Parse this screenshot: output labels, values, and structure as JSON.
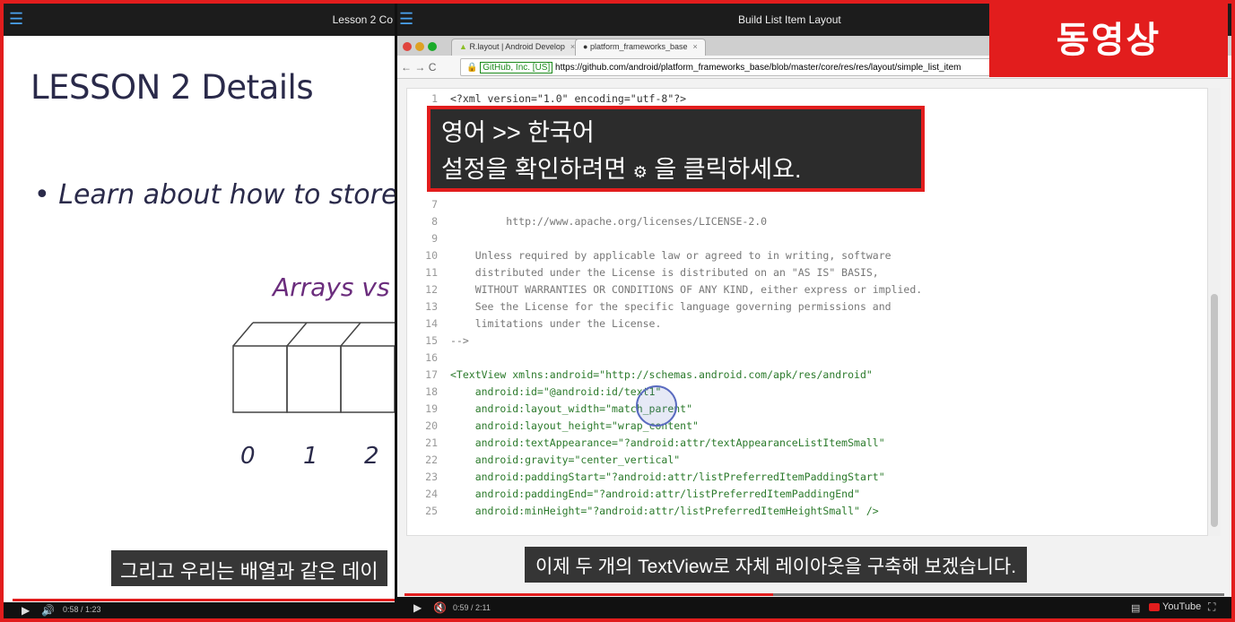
{
  "colors": {
    "accent_red": "#e21d1d",
    "brand_blue": "#4aa3f0"
  },
  "badge": {
    "label": "동영상"
  },
  "left_player": {
    "menu_icon": "menu-icon",
    "title": "Lesson 2 Co",
    "lesson_heading": "LESSON 2 Details",
    "bullet_text": "• Learn about how to store",
    "arrays_text": "Arrays vs",
    "indices": [
      "0",
      "1",
      "2"
    ],
    "subtitle": "그리고 우리는 배열과 같은 데이",
    "time": "0:58 / 1:23",
    "progress": 1.0
  },
  "right_player": {
    "menu_icon": "menu-icon",
    "title": "Build List Item Layout",
    "tabs": [
      {
        "label": "R.layout | Android Develop",
        "icon": "android-icon"
      },
      {
        "label": "platform_frameworks_base",
        "icon": "github-icon"
      }
    ],
    "address": {
      "cert": "GitHub, Inc. [US]",
      "url": "https://github.com/android/platform_frameworks_base/blob/master/core/res/res/layout/simple_list_item"
    },
    "code_lines": [
      {
        "n": "1",
        "text": "<?xml version=\"1.0\" encoding=\"utf-8\"?>"
      },
      {
        "n": "7",
        "text": ""
      },
      {
        "n": "8",
        "text": "         http://www.apache.org/licenses/LICENSE-2.0"
      },
      {
        "n": "9",
        "text": ""
      },
      {
        "n": "10",
        "text": "    Unless required by applicable law or agreed to in writing, software"
      },
      {
        "n": "11",
        "text": "    distributed under the License is distributed on an \"AS IS\" BASIS,"
      },
      {
        "n": "12",
        "text": "    WITHOUT WARRANTIES OR CONDITIONS OF ANY KIND, either express or implied."
      },
      {
        "n": "13",
        "text": "    See the License for the specific language governing permissions and"
      },
      {
        "n": "14",
        "text": "    limitations under the License."
      },
      {
        "n": "15",
        "text": "-->"
      },
      {
        "n": "16",
        "text": ""
      },
      {
        "n": "17",
        "text": "<TextView xmlns:android=\"http://schemas.android.com/apk/res/android\""
      },
      {
        "n": "18",
        "text": "    android:id=\"@android:id/text1\""
      },
      {
        "n": "19",
        "text": "    android:layout_width=\"match_parent\""
      },
      {
        "n": "20",
        "text": "    android:layout_height=\"wrap_content\""
      },
      {
        "n": "21",
        "text": "    android:textAppearance=\"?android:attr/textAppearanceListItemSmall\""
      },
      {
        "n": "22",
        "text": "    android:gravity=\"center_vertical\""
      },
      {
        "n": "23",
        "text": "    android:paddingStart=\"?android:attr/listPreferredItemPaddingStart\""
      },
      {
        "n": "24",
        "text": "    android:paddingEnd=\"?android:attr/listPreferredItemPaddingEnd\""
      },
      {
        "n": "25",
        "text": "    android:minHeight=\"?android:attr/listPreferredItemHeightSmall\" />"
      }
    ],
    "settings_overlay": {
      "line1": "영어 >> 한국어",
      "line2_before": "설정을 확인하려면",
      "gear_icon": "gear-icon",
      "line2_after": "을 클릭하세요."
    },
    "subtitle": "이제 두 개의 TextView로 자체 레이아웃을 구축해 보겠습니다.",
    "time": "0:59 / 2:11",
    "progress": 0.45,
    "youtube_label": "YouTube"
  }
}
